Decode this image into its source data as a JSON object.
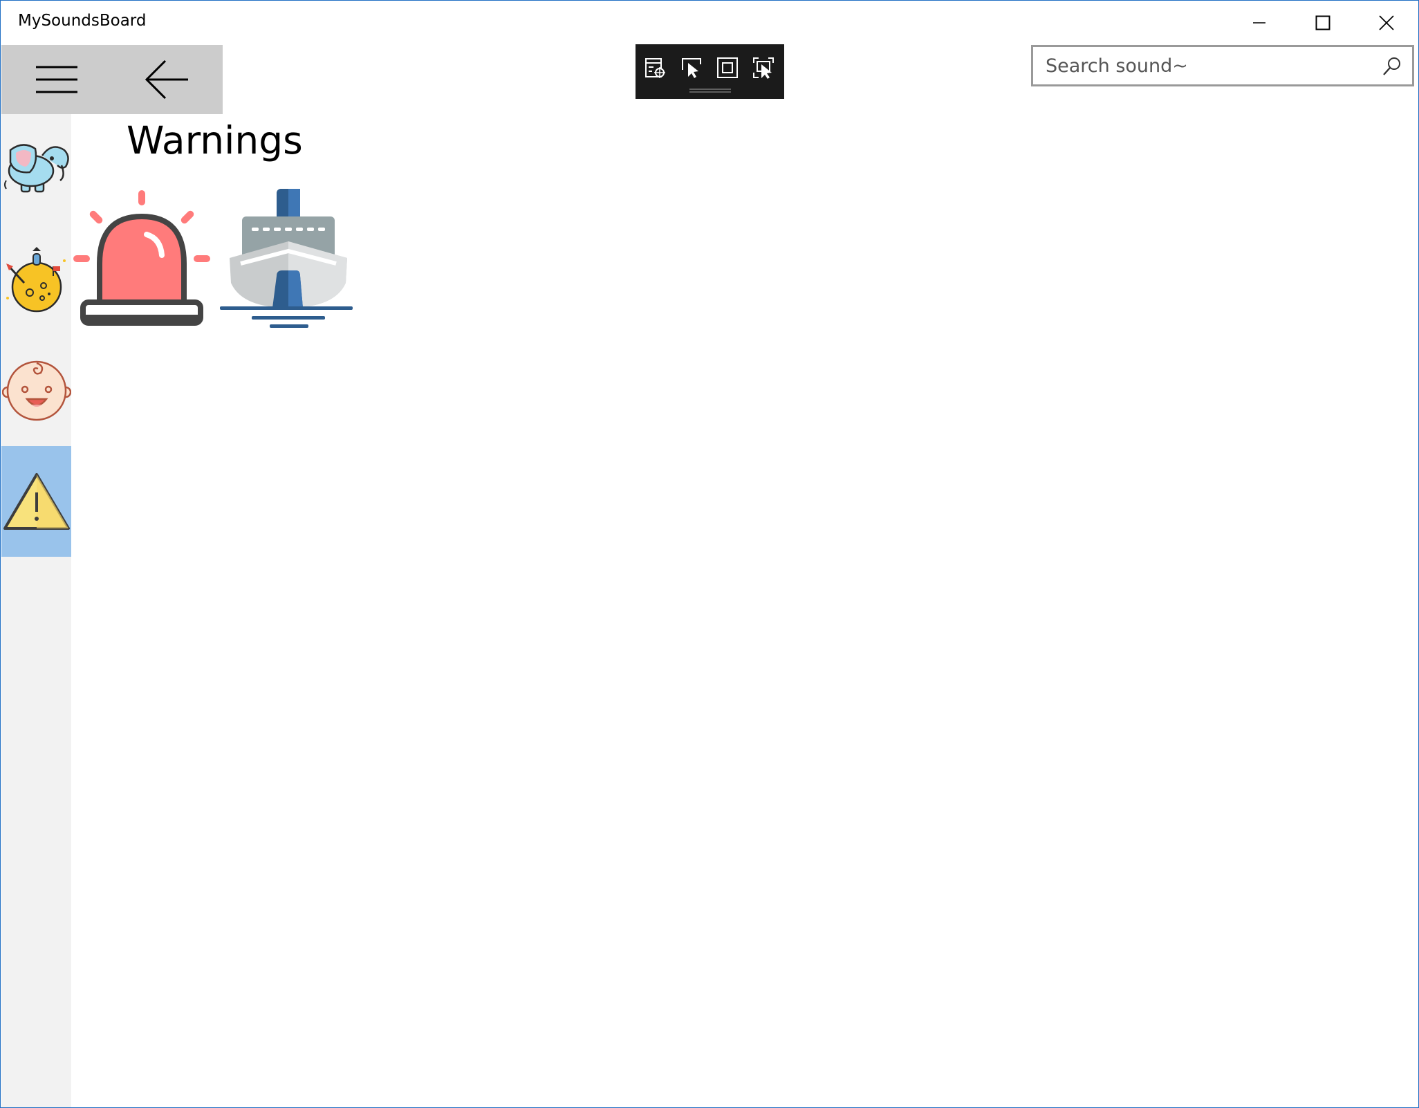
{
  "app": {
    "title": "MySoundsBoard"
  },
  "window_controls": {
    "minimize": "minimize-icon",
    "maximize": "maximize-icon",
    "close": "close-icon"
  },
  "nav": {
    "menu_icon": "hamburger-icon",
    "back_icon": "back-arrow-icon"
  },
  "debug_toolbar": {
    "icons": [
      "live-visual-tree-icon",
      "select-element-icon",
      "display-layout-adorners-icon",
      "track-focused-element-icon"
    ]
  },
  "search": {
    "placeholder": "Search sound~",
    "value": "",
    "icon": "search-icon"
  },
  "sidebar": {
    "items": [
      {
        "icon": "elephant-icon",
        "selected": false
      },
      {
        "icon": "moon-rocket-icon",
        "selected": false
      },
      {
        "icon": "baby-face-icon",
        "selected": false
      },
      {
        "icon": "warning-triangle-icon",
        "selected": true
      }
    ],
    "selected_color": "#99c3eb"
  },
  "page": {
    "title": "Warnings"
  },
  "sounds": [
    {
      "icon": "siren-icon"
    },
    {
      "icon": "ship-icon"
    }
  ],
  "colors": {
    "accent_border": "#1f6fc4",
    "nav_bg": "#cccccc",
    "sidebar_bg": "#f2f2f2"
  }
}
